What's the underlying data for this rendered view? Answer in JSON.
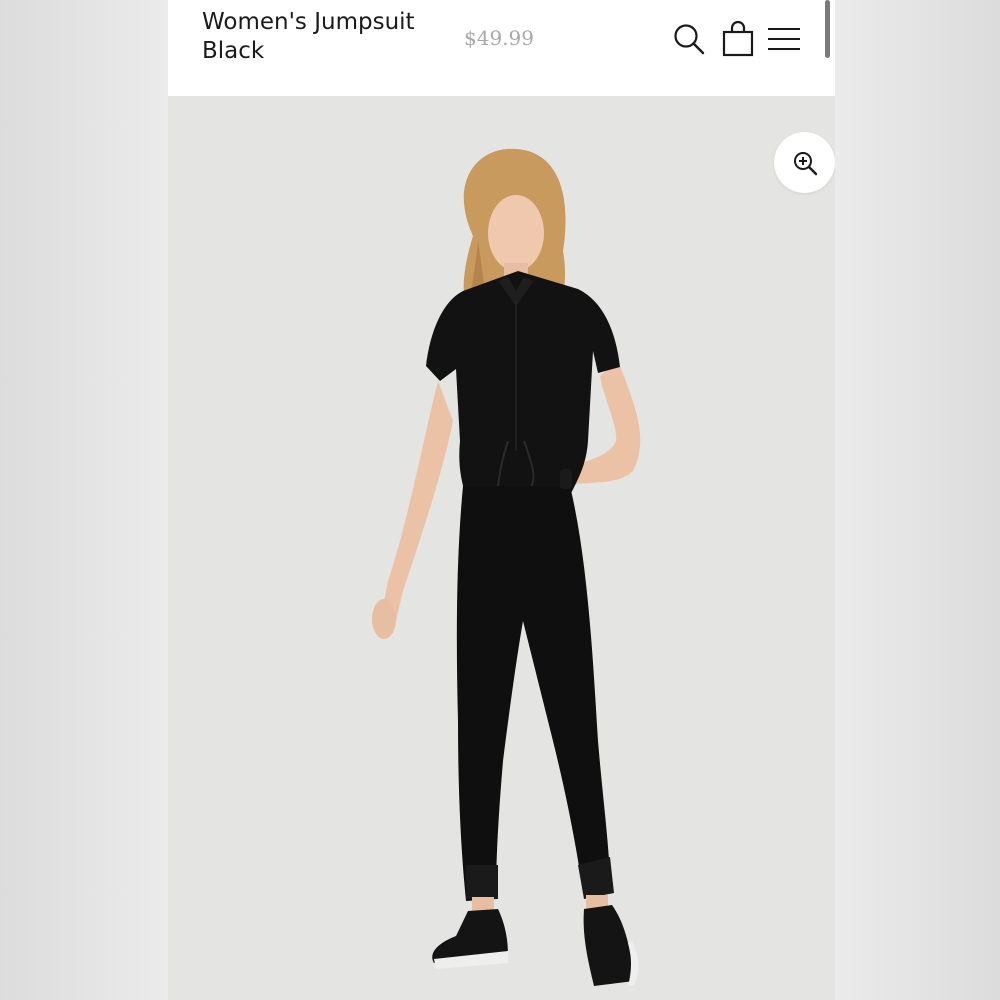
{
  "product": {
    "title": "Women's Jumpsuit Black",
    "price": "$49.99"
  },
  "header": {
    "icons": [
      "search-icon",
      "shopping-bag-icon",
      "menu-icon"
    ]
  },
  "image": {
    "zoom_icon": "zoom-in-icon"
  },
  "colors": {
    "header_bg": "#ffffff",
    "image_bg": "#e4e4e2",
    "title_text": "#1a1a1a",
    "price_text": "#a8a8a8",
    "jumpsuit": "#111111"
  }
}
